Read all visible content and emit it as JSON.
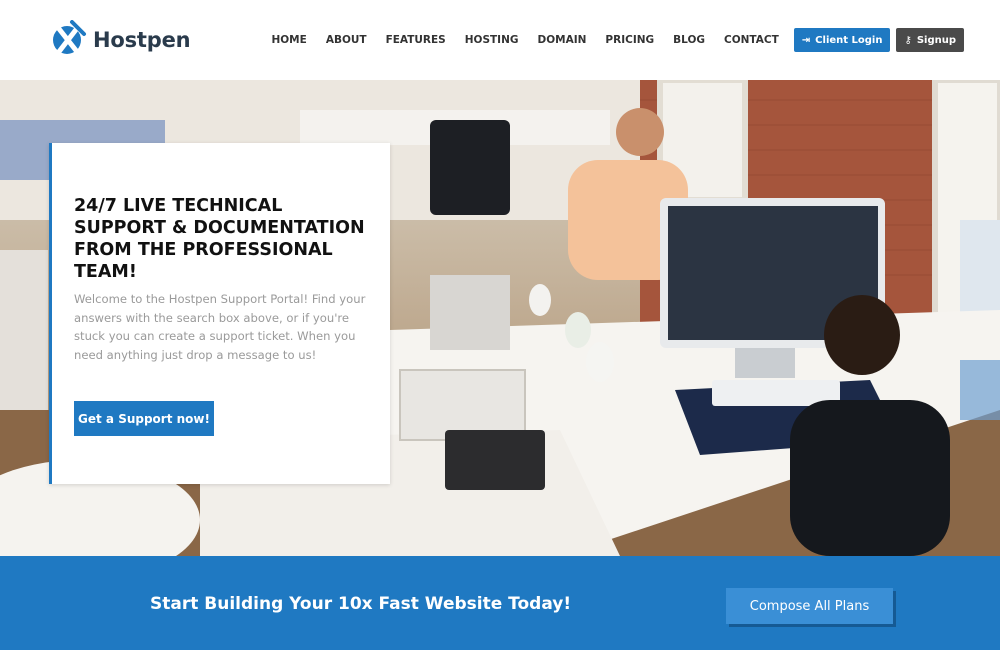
{
  "brand": {
    "name": "Hostpen",
    "logo_icon": "hostpen-x-logo",
    "accent": "#1f79c2"
  },
  "nav": {
    "items": [
      {
        "label": "HOME"
      },
      {
        "label": "ABOUT"
      },
      {
        "label": "FEATURES"
      },
      {
        "label": "HOSTING"
      },
      {
        "label": "DOMAIN"
      },
      {
        "label": "PRICING"
      },
      {
        "label": "BLOG"
      },
      {
        "label": "CONTACT"
      }
    ],
    "login": {
      "label": "Client Login",
      "icon": "sign-in-icon"
    },
    "signup": {
      "label": "Signup",
      "icon": "key-icon"
    }
  },
  "hero": {
    "title": "24/7 LIVE TECHNICAL SUPPORT & DOCUMENTATION FROM THE PROFESSIONAL TEAM!",
    "text": "Welcome to the Hostpen Support Portal! Find your answers with the search box above, or if you're stuck you can create a support ticket. When you need anything just drop a message to us!",
    "button": "Get a Support now!"
  },
  "cta": {
    "text": "Start Building Your 10x Fast Website Today!",
    "button": "Compose All Plans"
  }
}
